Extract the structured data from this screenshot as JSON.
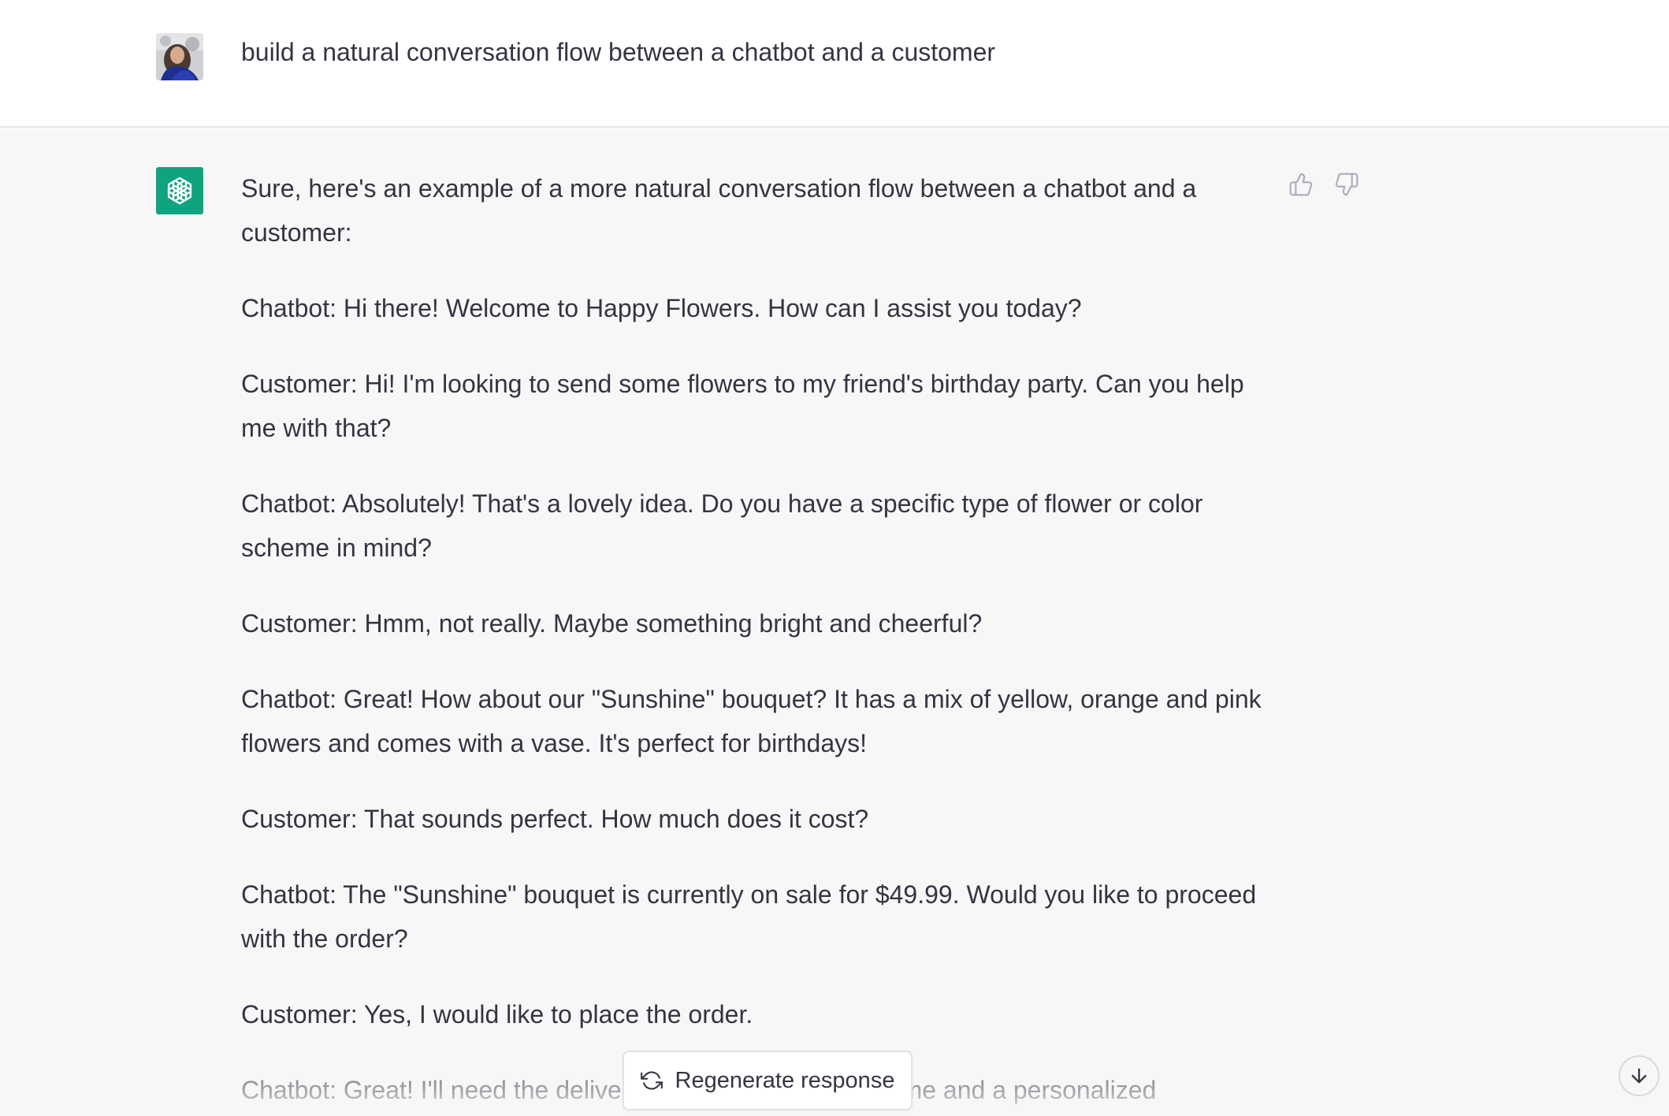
{
  "user_message": {
    "text": "build a natural conversation flow between a chatbot and a customer"
  },
  "assistant_message": {
    "paragraphs": [
      "Sure, here's an example of a more natural conversation flow between a chatbot and a customer:",
      "Chatbot: Hi there! Welcome to Happy Flowers. How can I assist you today?",
      "Customer: Hi! I'm looking to send some flowers to my friend's birthday party. Can you help me with that?",
      "Chatbot: Absolutely! That's a lovely idea. Do you have a specific type of flower or color scheme in mind?",
      "Customer: Hmm, not really. Maybe something bright and cheerful?",
      "Chatbot: Great! How about our \"Sunshine\" bouquet? It has a mix of yellow, orange and pink flowers and comes with a vase. It's perfect for birthdays!",
      "Customer: That sounds perfect. How much does it cost?",
      "Chatbot: The \"Sunshine\" bouquet is currently on sale for $49.99. Would you like to proceed with the order?",
      "Customer: Yes, I would like to place the order.",
      "Chatbot: Great! I'll need the delivery address, recipient's name and a personalized"
    ]
  },
  "actions": {
    "regenerate_label": "Regenerate response"
  },
  "icons": {
    "user_avatar": "user-avatar-photo",
    "bot_avatar": "openai-logo-icon",
    "thumbs_up": "thumbs-up-icon",
    "thumbs_down": "thumbs-down-icon",
    "regenerate": "refresh-icon",
    "scroll_down": "arrow-down-icon"
  },
  "colors": {
    "bot_avatar_bg": "#10a37f",
    "assistant_bg": "#f7f7f8",
    "text": "#343541"
  }
}
